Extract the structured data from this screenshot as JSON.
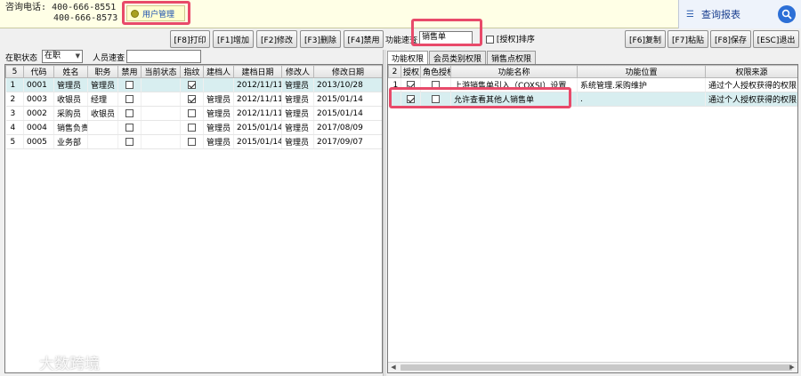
{
  "topbar": {
    "phone_label": "咨询电话:",
    "phone1": "400-666-8551",
    "phone2": "400-666-8573",
    "user_tab": "用户管理",
    "query_report": "查询报表"
  },
  "toolbar": {
    "print": "[F8]打印",
    "add": "[F1]增加",
    "edit": "[F2]修改",
    "delete": "[F3]删除",
    "disable": "[F4]禁用",
    "func_search_label": "功能速查",
    "func_search_value": "销售单",
    "authorize_sort": "[授权]排序",
    "copy": "[F6]复制",
    "paste": "[F7]粘贴",
    "save": "[F8]保存",
    "exit": "[ESC]退出"
  },
  "filter": {
    "status_label": "在职状态",
    "status_value": "在职",
    "person_search_label": "人员速查"
  },
  "users_table": {
    "count": "5",
    "headers": [
      "代码",
      "姓名",
      "职务",
      "禁用",
      "当前状态",
      "指纹",
      "建档人",
      "建档日期",
      "修改人",
      "修改日期"
    ],
    "rows": [
      {
        "n": "1",
        "code": "0001",
        "name": "管理员",
        "role": "管理员",
        "disabled": false,
        "state": "",
        "fp": true,
        "creator": "",
        "cdate": "2012/11/11",
        "modifier": "管理员",
        "mdate": "2013/10/28"
      },
      {
        "n": "2",
        "code": "0003",
        "name": "收银员",
        "role": "经理",
        "disabled": false,
        "state": "",
        "fp": true,
        "creator": "管理员",
        "cdate": "2012/11/11",
        "modifier": "管理员",
        "mdate": "2015/01/14"
      },
      {
        "n": "3",
        "code": "0002",
        "name": "采购员",
        "role": "收银员",
        "disabled": false,
        "state": "",
        "fp": false,
        "creator": "管理员",
        "cdate": "2012/11/11",
        "modifier": "管理员",
        "mdate": "2015/01/14"
      },
      {
        "n": "4",
        "code": "0004",
        "name": "销售负责人",
        "role": "",
        "disabled": false,
        "state": "",
        "fp": false,
        "creator": "管理员",
        "cdate": "2015/01/14",
        "modifier": "管理员",
        "mdate": "2017/08/09"
      },
      {
        "n": "5",
        "code": "0005",
        "name": "业务部",
        "role": "",
        "disabled": false,
        "state": "",
        "fp": false,
        "creator": "管理员",
        "cdate": "2015/01/14",
        "modifier": "管理员",
        "mdate": "2017/09/07"
      }
    ]
  },
  "right_tabs": [
    "功能权限",
    "会员类别权限",
    "销售点权限"
  ],
  "perm_table": {
    "count": "2",
    "headers": [
      "授权",
      "角色授权",
      "功能名称",
      "功能位置",
      "权限来源"
    ],
    "rows": [
      {
        "n": "1",
        "auth": true,
        "role_auth": false,
        "name": "上游销售单引入（COXSI）设置",
        "location": "系统管理.采购维护",
        "source": "通过个人授权获得的权限"
      },
      {
        "n": "",
        "auth": true,
        "role_auth": false,
        "name": "允许查看其他人销售单",
        "location": ".",
        "source": "通过个人授权获得的权限"
      }
    ]
  },
  "watermark": "大数跨境"
}
